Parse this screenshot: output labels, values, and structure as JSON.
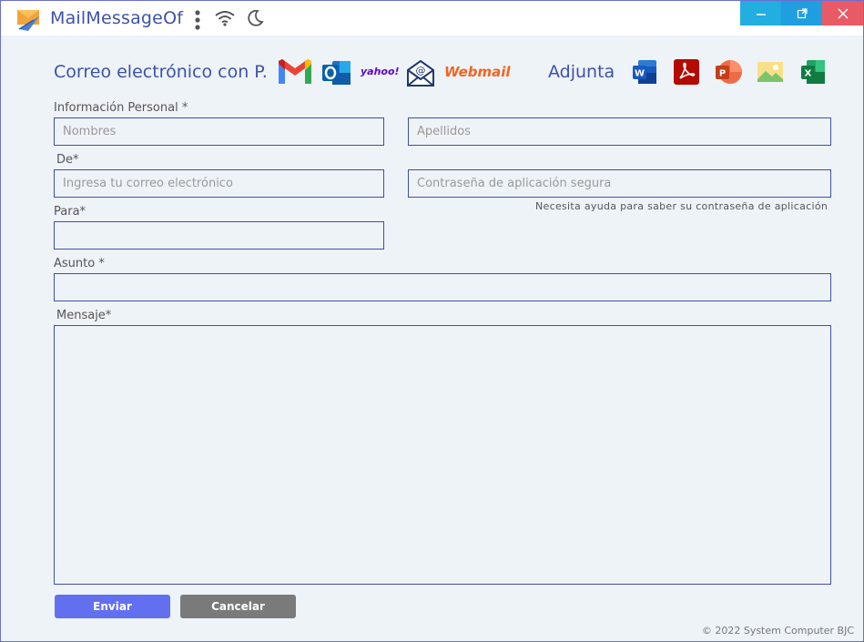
{
  "app": {
    "title": "MailMessageOf"
  },
  "window_controls": {
    "minimize": "—",
    "maximize": "⧉",
    "close": "✕"
  },
  "header": {
    "title": "Correo electrónico con P.",
    "attach_label": "Adjunta",
    "providers": [
      "gmail-icon",
      "outlook-icon",
      "yahoo-icon",
      "mail-icon",
      "webmail-icon"
    ],
    "yahoo_text": "yahoo!",
    "webmail_text": "Webmail",
    "attachments": [
      "word-icon",
      "pdf-icon",
      "powerpoint-icon",
      "image-icon",
      "excel-icon"
    ]
  },
  "form": {
    "personal_label": "Información Personal *",
    "first_name_placeholder": "Nombres",
    "last_name_placeholder": "Apellidos",
    "from_label": "De*",
    "email_placeholder": "Ingresa tu correo electrónico",
    "password_placeholder": "Contraseña de aplicación segura",
    "help_text": "Necesita ayuda para saber su contraseña de aplicación",
    "to_label": "Para*",
    "subject_label": "Asunto *",
    "message_label": "Mensaje*"
  },
  "actions": {
    "send": "Enviar",
    "cancel": "Cancelar"
  },
  "footer": {
    "copyright": "© 2022 System Computer BJC"
  },
  "colors": {
    "accent": "#3d52a8",
    "send": "#6270f0",
    "cancel": "#7a7a7a",
    "close": "#e95a67",
    "minimize": "#22aee0"
  }
}
